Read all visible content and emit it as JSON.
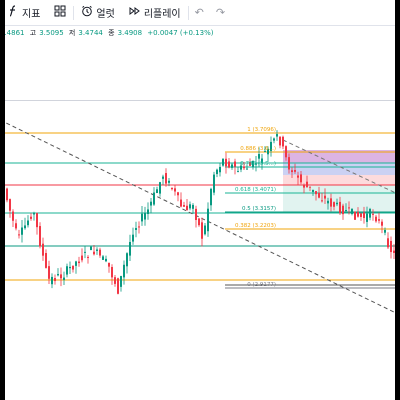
{
  "toolbar": {
    "indicators": {
      "icon": "function-icon",
      "label": "지표"
    },
    "layout": {
      "icon": "layout-grid-icon"
    },
    "alert": {
      "icon": "alarm-clock-icon",
      "label": "얼럿"
    },
    "replay": {
      "icon": "replay-icon",
      "label": "리플레이"
    },
    "undo": {
      "icon": "undo-icon"
    },
    "redo": {
      "icon": "redo-icon"
    }
  },
  "ohlc": {
    "open_value": "3.4861",
    "high_label": "고",
    "high_value": "3.5095",
    "low_label": "저",
    "low_value": "3.4744",
    "close_label": "종",
    "close_value": "3.4908",
    "change": "+0.0047 (+0.13%)"
  },
  "fib_levels": [
    {
      "label": "1 (3.7096)",
      "color": "#f0a40a"
    },
    {
      "label": "0.886 (3.6...)",
      "color": "#f0a40a"
    },
    {
      "label": "0.786 (3.5...)",
      "color": "#1ab394"
    },
    {
      "label": "0.618 (3.4071)",
      "color": "#1ab394"
    },
    {
      "label": "0.5 (3.3157)",
      "color": "#089981"
    },
    {
      "label": "0.382 (3.2203)",
      "color": "#f0a40a"
    },
    {
      "label": "0 (2.9177)",
      "color": "#787b86"
    }
  ],
  "colors": {
    "up": "#089981",
    "down": "#f23645",
    "fib_orange": "#f0a40a",
    "fib_teal": "#1ab394",
    "fib_green": "#089981",
    "zone_magenta": "#9c27b0",
    "zone_blue": "#6b7bdc"
  }
}
